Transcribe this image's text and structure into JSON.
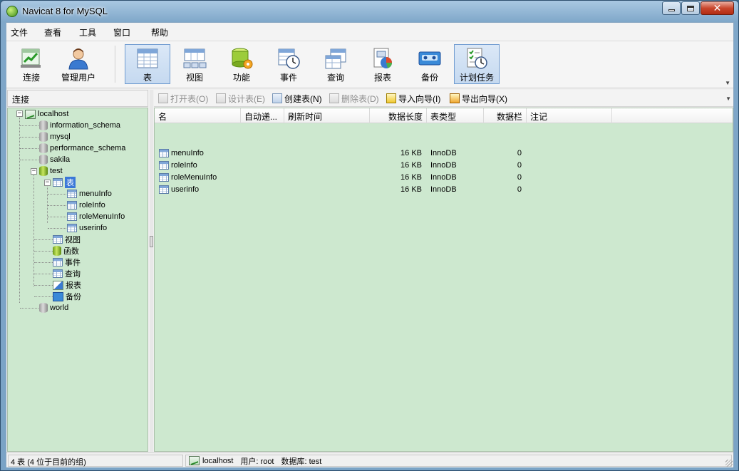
{
  "window": {
    "title": "Navicat 8 for MySQL"
  },
  "menu": [
    "文件",
    "查看",
    "工具",
    "窗口",
    "帮助"
  ],
  "toolbar": [
    {
      "label": "连接",
      "icon": "connect-icon"
    },
    {
      "label": "管理用户",
      "icon": "user-icon"
    },
    {
      "label": "表",
      "icon": "table-icon",
      "active": true
    },
    {
      "label": "视图",
      "icon": "view-icon"
    },
    {
      "label": "功能",
      "icon": "function-icon"
    },
    {
      "label": "事件",
      "icon": "event-icon"
    },
    {
      "label": "查询",
      "icon": "query-icon"
    },
    {
      "label": "报表",
      "icon": "report-icon"
    },
    {
      "label": "备份",
      "icon": "backup-icon"
    },
    {
      "label": "计划任务",
      "icon": "schedule-icon",
      "active": true
    }
  ],
  "left_panel": {
    "header": "连接",
    "tree": {
      "connection": "localhost",
      "databases_before": [
        "information_schema",
        "mysql",
        "performance_schema",
        "sakila"
      ],
      "open_database": "test",
      "tables_node": "表",
      "tables": [
        "menuInfo",
        "roleInfo",
        "roleMenuInfo",
        "userinfo"
      ],
      "objects": [
        "视图",
        "函数",
        "事件",
        "查询",
        "报表",
        "备份"
      ],
      "databases_after": [
        "world"
      ]
    }
  },
  "sub_toolbar": [
    {
      "label": "打开表(O)",
      "enabled": false
    },
    {
      "label": "设计表(E)",
      "enabled": false
    },
    {
      "label": "创建表(N)",
      "enabled": true
    },
    {
      "label": "删除表(D)",
      "enabled": false
    },
    {
      "label": "导入向导(I)",
      "enabled": true
    },
    {
      "label": "导出向导(X)",
      "enabled": true
    }
  ],
  "table_list": {
    "columns": [
      "名",
      "自动递...",
      "刷新时间",
      "数据长度",
      "表类型",
      "数据栏",
      "注记"
    ],
    "rows": [
      {
        "name": "menuInfo",
        "auto_inc": "",
        "refresh": "",
        "data_length": "16 KB",
        "engine": "InnoDB",
        "rows": "0",
        "comment": ""
      },
      {
        "name": "roleInfo",
        "auto_inc": "",
        "refresh": "",
        "data_length": "16 KB",
        "engine": "InnoDB",
        "rows": "0",
        "comment": ""
      },
      {
        "name": "roleMenuInfo",
        "auto_inc": "",
        "refresh": "",
        "data_length": "16 KB",
        "engine": "InnoDB",
        "rows": "0",
        "comment": ""
      },
      {
        "name": "userinfo",
        "auto_inc": "",
        "refresh": "",
        "data_length": "16 KB",
        "engine": "InnoDB",
        "rows": "0",
        "comment": ""
      }
    ]
  },
  "status": {
    "summary": "4 表 (4 位于目前的组)",
    "connection": "localhost",
    "user": "用户: root",
    "database": "数据库: test"
  },
  "colors": {
    "tree_bg": "#cde8cf",
    "selection": "#3b78d8",
    "titlebar": "#7fa7c9"
  }
}
